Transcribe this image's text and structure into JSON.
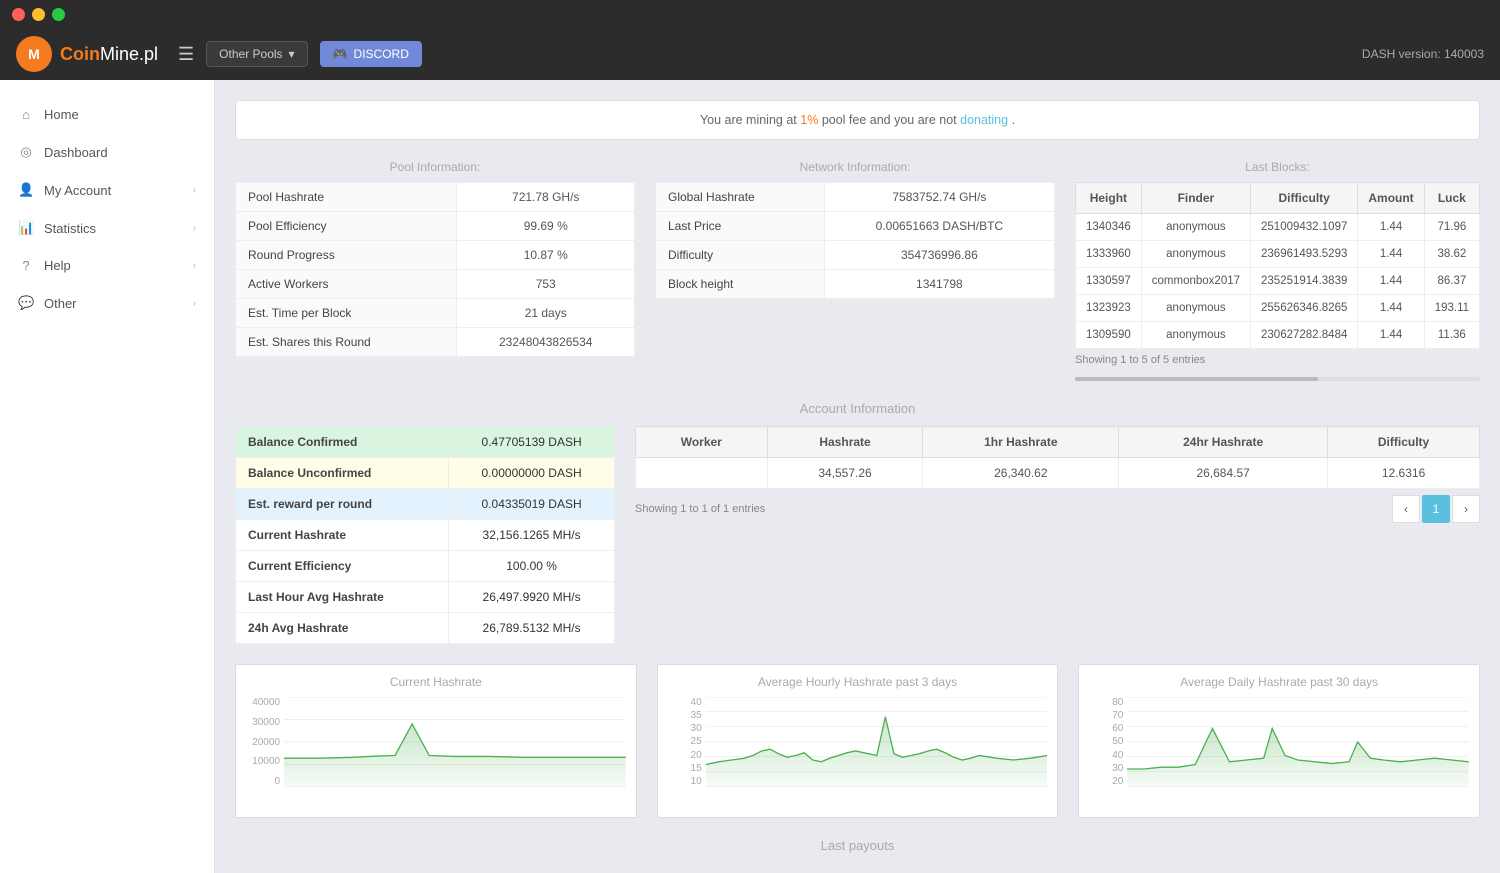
{
  "os_bar": {},
  "navbar": {
    "brand": "CoinMine.pl",
    "brand_strong": "Coin",
    "brand_rest": "Mine.pl",
    "toggle_icon": "☰",
    "other_pools_label": "Other Pools",
    "discord_label": "DISCORD",
    "dash_version": "DASH version: 140003"
  },
  "sidebar": {
    "items": [
      {
        "id": "home",
        "icon": "⌂",
        "label": "Home",
        "arrow": false
      },
      {
        "id": "dashboard",
        "icon": "◉",
        "label": "Dashboard",
        "arrow": false
      },
      {
        "id": "my-account",
        "icon": "👤",
        "label": "My Account",
        "arrow": true
      },
      {
        "id": "statistics",
        "icon": "📊",
        "label": "Statistics",
        "arrow": true
      },
      {
        "id": "help",
        "icon": "?",
        "label": "Help",
        "arrow": true
      },
      {
        "id": "other",
        "icon": "💬",
        "label": "Other",
        "arrow": true
      }
    ]
  },
  "alert": {
    "text_before": "You are mining at ",
    "percent": "1%",
    "text_middle": " pool fee and you are not ",
    "link_text": "donating",
    "text_after": "."
  },
  "pool_info": {
    "title": "Pool Information:",
    "rows": [
      {
        "label": "Pool Hashrate",
        "value": "721.78 GH/s"
      },
      {
        "label": "Pool Efficiency",
        "value": "99.69 %"
      },
      {
        "label": "Round Progress",
        "value": "10.87 %"
      },
      {
        "label": "Active Workers",
        "value": "753"
      },
      {
        "label": "Est. Time per Block",
        "value": "21 days"
      },
      {
        "label": "Est. Shares this Round",
        "value": "23248043826534"
      }
    ]
  },
  "network_info": {
    "title": "Network Information:",
    "rows": [
      {
        "label": "Global Hashrate",
        "value": "7583752.74 GH/s"
      },
      {
        "label": "Last Price",
        "value": "0.00651663 DASH/BTC"
      },
      {
        "label": "Difficulty",
        "value": "354736996.86"
      },
      {
        "label": "Block height",
        "value": "1341798"
      }
    ]
  },
  "last_blocks": {
    "title": "Last Blocks:",
    "columns": [
      "Height",
      "Finder",
      "Difficulty",
      "Amount",
      "Luck"
    ],
    "rows": [
      {
        "height": "1340346",
        "finder": "anonymous",
        "difficulty": "251009432.1097",
        "amount": "1.44",
        "luck": "71.96"
      },
      {
        "height": "1333960",
        "finder": "anonymous",
        "difficulty": "236961493.5293",
        "amount": "1.44",
        "luck": "38.62"
      },
      {
        "height": "1330597",
        "finder": "commonbox2017",
        "difficulty": "235251914.3839",
        "amount": "1.44",
        "luck": "86.37"
      },
      {
        "height": "1323923",
        "finder": "anonymous",
        "difficulty": "255626346.8265",
        "amount": "1.44",
        "luck": "193.11"
      },
      {
        "height": "1309590",
        "finder": "anonymous",
        "difficulty": "230627282.8484",
        "amount": "1.44",
        "luck": "11.36"
      }
    ],
    "footer": "Showing 1 to 5 of 5 entries"
  },
  "account_info": {
    "title": "Account Information",
    "balance": {
      "rows": [
        {
          "label": "Balance Confirmed",
          "value": "0.47705139 DASH",
          "style": "green"
        },
        {
          "label": "Balance Unconfirmed",
          "value": "0.00000000 DASH",
          "style": "yellow"
        },
        {
          "label": "Est. reward per round",
          "value": "0.04335019 DASH",
          "style": "blue"
        },
        {
          "label": "Current Hashrate",
          "value": "32,156.1265 MH/s",
          "style": "normal"
        },
        {
          "label": "Current Efficiency",
          "value": "100.00 %",
          "style": "normal"
        },
        {
          "label": "Last Hour Avg Hashrate",
          "value": "26,497.9920 MH/s",
          "style": "normal"
        },
        {
          "label": "24h Avg Hashrate",
          "value": "26,789.5132 MH/s",
          "style": "normal"
        }
      ]
    },
    "workers": {
      "columns": [
        "Worker",
        "Hashrate",
        "1hr Hashrate",
        "24hr Hashrate",
        "Difficulty"
      ],
      "rows": [
        {
          "worker": "",
          "hashrate": "34,557.26",
          "hr1": "26,340.62",
          "hr24": "26,684.57",
          "difficulty": "12.6316"
        }
      ],
      "footer": "Showing 1 to 1 of 1 entries",
      "pagination": [
        "‹",
        "1",
        "›"
      ]
    }
  },
  "charts": {
    "current_hashrate": {
      "title": "Current Hashrate",
      "y_labels": [
        "40000",
        "30000",
        "20000",
        "10000",
        "0"
      ]
    },
    "hourly": {
      "title": "Average Hourly Hashrate past 3 days",
      "y_labels": [
        "40",
        "35",
        "30",
        "25",
        "20",
        "15",
        "10"
      ]
    },
    "daily": {
      "title": "Average Daily Hashrate past 30 days",
      "y_labels": [
        "80",
        "70",
        "60",
        "50",
        "40",
        "30",
        "20"
      ]
    }
  },
  "last_payouts_title": "Last payouts"
}
